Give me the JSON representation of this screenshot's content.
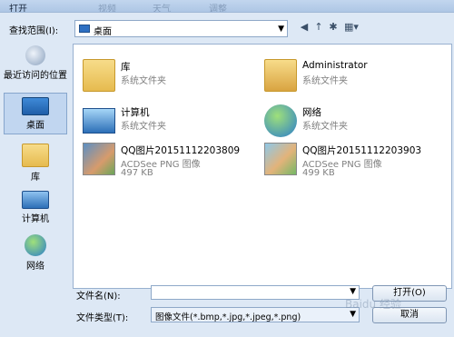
{
  "window": {
    "title": "打开",
    "ghost_items": [
      "视频",
      "天气",
      "调整"
    ]
  },
  "toolbar": {
    "lookin_label": "查找范围(I):",
    "lookin_value": "桌面"
  },
  "places": [
    {
      "label": "最近访问的位置",
      "icon": "recent-places-icon"
    },
    {
      "label": "桌面",
      "icon": "desktop-icon",
      "active": true
    },
    {
      "label": "库",
      "icon": "libraries-icon"
    },
    {
      "label": "计算机",
      "icon": "computer-icon"
    },
    {
      "label": "网络",
      "icon": "network-icon"
    }
  ],
  "files": [
    {
      "name": "库",
      "type": "系统文件夹",
      "size": ""
    },
    {
      "name": "Administrator",
      "type": "系统文件夹",
      "size": ""
    },
    {
      "name": "计算机",
      "type": "系统文件夹",
      "size": ""
    },
    {
      "name": "网络",
      "type": "系统文件夹",
      "size": ""
    },
    {
      "name": "QQ图片20151112203809",
      "type": "ACDSee PNG 图像",
      "size": "497 KB"
    },
    {
      "name": "QQ图片20151112203903",
      "type": "ACDSee PNG 图像",
      "size": "499 KB"
    }
  ],
  "footer": {
    "filename_label": "文件名(N):",
    "filename_value": "",
    "filetype_label": "文件类型(T):",
    "filetype_value": "图像文件(*.bmp,*.jpg,*.jpeg,*.png)",
    "open_label": "打开(O)",
    "cancel_label": "取消"
  },
  "watermark": "Baidu 经验"
}
